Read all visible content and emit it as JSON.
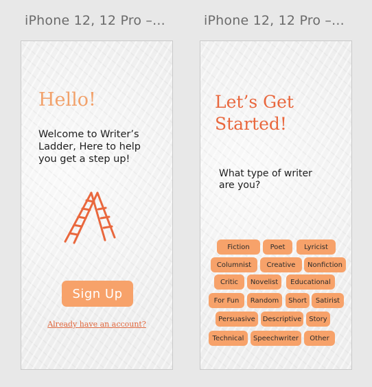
{
  "frames": [
    {
      "title": "iPhone 12, 12 Pro –..."
    },
    {
      "title": "iPhone 12, 12 Pro –..."
    }
  ],
  "welcome_screen": {
    "heading": "Hello!",
    "message": "Welcome to Writer’s Ladder, Here to help you get a step up!",
    "ladder_icon": "ladder-icon",
    "signup_label": "Sign Up",
    "login_link": "Already have an account?"
  },
  "start_screen": {
    "heading_line1": "Let’s Get",
    "heading_line2": "Started!",
    "question": "What type of writer are you?",
    "writer_types": [
      "Fiction",
      "Poet",
      "Lyricist",
      "Columnist",
      "Creative",
      "Nonfiction",
      "Critic",
      "Novelist",
      "Educational",
      "For Fun",
      "Random",
      "Short",
      "Satirist",
      "Persuasive",
      "Descriptive",
      "Story",
      "Technical",
      "Speechwriter",
      "Other"
    ]
  },
  "colors": {
    "accent": "#f7a26a",
    "heading_orange": "#e9673d",
    "link": "#e0673d",
    "background": "#e8e8e8"
  }
}
